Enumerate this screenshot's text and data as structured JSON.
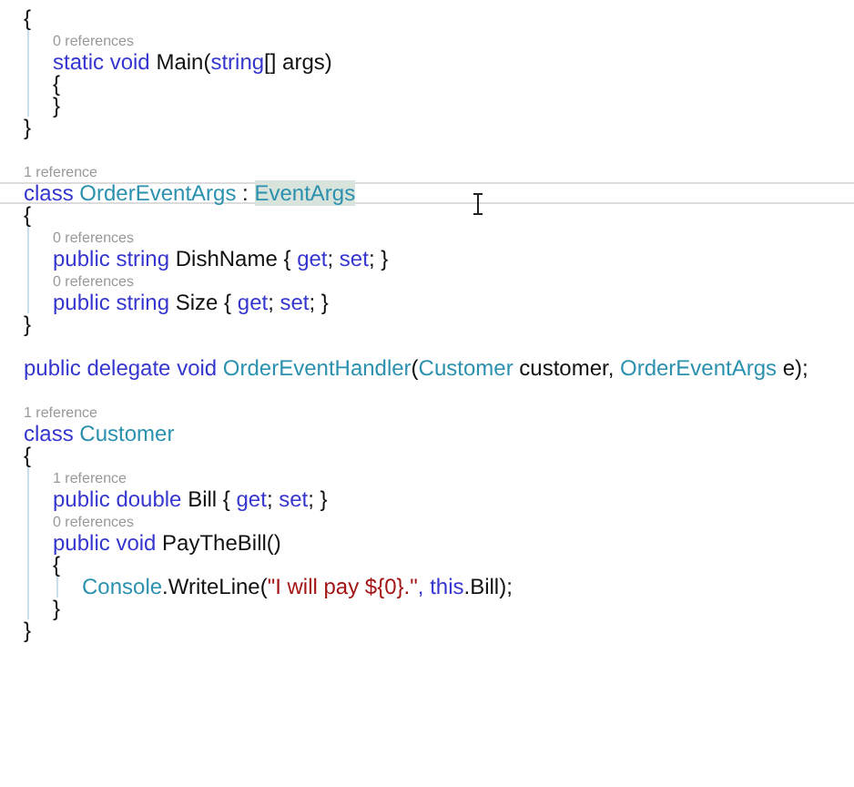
{
  "editor": {
    "lines": [
      {
        "kind": "code",
        "current": false,
        "tokens": [
          {
            "text": "{",
            "kind": "plain"
          }
        ]
      },
      {
        "kind": "block",
        "children": [
          {
            "kind": "lens",
            "text": "0 references"
          },
          {
            "kind": "code",
            "current": false,
            "tokens": [
              {
                "text": "static void",
                "kind": "keyword"
              },
              {
                "text": " Main(",
                "kind": "plain"
              },
              {
                "text": "string",
                "kind": "keyword"
              },
              {
                "text": "[] args)",
                "kind": "plain"
              }
            ]
          },
          {
            "kind": "code",
            "current": false,
            "tokens": [
              {
                "text": "{",
                "kind": "plain"
              }
            ]
          },
          {
            "kind": "code",
            "current": false,
            "tokens": [
              {
                "text": "}",
                "kind": "plain"
              }
            ]
          }
        ]
      },
      {
        "kind": "code",
        "current": false,
        "tokens": [
          {
            "text": "}",
            "kind": "plain"
          }
        ]
      },
      {
        "kind": "blank"
      },
      {
        "kind": "lens",
        "text": "1 reference"
      },
      {
        "kind": "code",
        "current": true,
        "tokens": [
          {
            "text": "class",
            "kind": "keyword"
          },
          {
            "text": " OrderEventArgs",
            "kind": "type"
          },
          {
            "text": " : ",
            "kind": "plain"
          },
          {
            "text": "EventArgs",
            "kind": "type",
            "highlighted": true
          }
        ]
      },
      {
        "kind": "code",
        "current": false,
        "tokens": [
          {
            "text": "{",
            "kind": "plain"
          }
        ]
      },
      {
        "kind": "block",
        "children": [
          {
            "kind": "lens",
            "text": "0 references"
          },
          {
            "kind": "code",
            "current": false,
            "tokens": [
              {
                "text": "public string",
                "kind": "keyword"
              },
              {
                "text": " DishName { ",
                "kind": "plain"
              },
              {
                "text": "get",
                "kind": "keyword"
              },
              {
                "text": "; ",
                "kind": "plain"
              },
              {
                "text": "set",
                "kind": "keyword"
              },
              {
                "text": "; }",
                "kind": "plain"
              }
            ]
          },
          {
            "kind": "lens",
            "text": "0 references"
          },
          {
            "kind": "code",
            "current": false,
            "tokens": [
              {
                "text": "public string",
                "kind": "keyword"
              },
              {
                "text": " Size { ",
                "kind": "plain"
              },
              {
                "text": "get",
                "kind": "keyword"
              },
              {
                "text": "; ",
                "kind": "plain"
              },
              {
                "text": "set",
                "kind": "keyword"
              },
              {
                "text": "; }",
                "kind": "plain"
              }
            ]
          }
        ]
      },
      {
        "kind": "code",
        "current": false,
        "tokens": [
          {
            "text": "}",
            "kind": "plain"
          }
        ]
      },
      {
        "kind": "blank"
      },
      {
        "kind": "code",
        "current": false,
        "tokens": [
          {
            "text": "public delegate void",
            "kind": "keyword"
          },
          {
            "text": " OrderEventHandler",
            "kind": "type"
          },
          {
            "text": "(",
            "kind": "plain"
          },
          {
            "text": "Customer",
            "kind": "type"
          },
          {
            "text": " customer, ",
            "kind": "plain"
          },
          {
            "text": "OrderEventArgs",
            "kind": "type"
          },
          {
            "text": " e);",
            "kind": "plain"
          }
        ]
      },
      {
        "kind": "blank"
      },
      {
        "kind": "lens",
        "text": "1 reference"
      },
      {
        "kind": "code",
        "current": false,
        "tokens": [
          {
            "text": "class",
            "kind": "keyword"
          },
          {
            "text": " Customer",
            "kind": "type"
          }
        ]
      },
      {
        "kind": "code",
        "current": false,
        "tokens": [
          {
            "text": "{",
            "kind": "plain"
          }
        ]
      },
      {
        "kind": "block",
        "children": [
          {
            "kind": "lens",
            "text": "1 reference"
          },
          {
            "kind": "code",
            "current": false,
            "tokens": [
              {
                "text": "public double",
                "kind": "keyword"
              },
              {
                "text": " Bill { ",
                "kind": "plain"
              },
              {
                "text": "get",
                "kind": "keyword"
              },
              {
                "text": "; ",
                "kind": "plain"
              },
              {
                "text": "set",
                "kind": "keyword"
              },
              {
                "text": "; }",
                "kind": "plain"
              }
            ]
          },
          {
            "kind": "lens",
            "text": "0 references"
          },
          {
            "kind": "code",
            "current": false,
            "tokens": [
              {
                "text": "public void",
                "kind": "keyword"
              },
              {
                "text": " PayTheBill()",
                "kind": "plain"
              }
            ]
          },
          {
            "kind": "code",
            "current": false,
            "tokens": [
              {
                "text": "{",
                "kind": "plain"
              }
            ]
          },
          {
            "kind": "block",
            "children": [
              {
                "kind": "code",
                "current": false,
                "tokens": [
                  {
                    "text": "Console",
                    "kind": "type"
                  },
                  {
                    "text": ".WriteLine(",
                    "kind": "plain"
                  },
                  {
                    "text": "\"I will pay ${0}.\"",
                    "kind": "string"
                  },
                  {
                    "text": ", this",
                    "kind": "keyword"
                  },
                  {
                    "text": ".Bill);",
                    "kind": "plain"
                  }
                ]
              }
            ]
          },
          {
            "kind": "code",
            "current": false,
            "tokens": [
              {
                "text": "}",
                "kind": "plain"
              }
            ]
          }
        ]
      },
      {
        "kind": "code",
        "current": false,
        "tokens": [
          {
            "text": "}",
            "kind": "plain"
          }
        ]
      }
    ]
  }
}
